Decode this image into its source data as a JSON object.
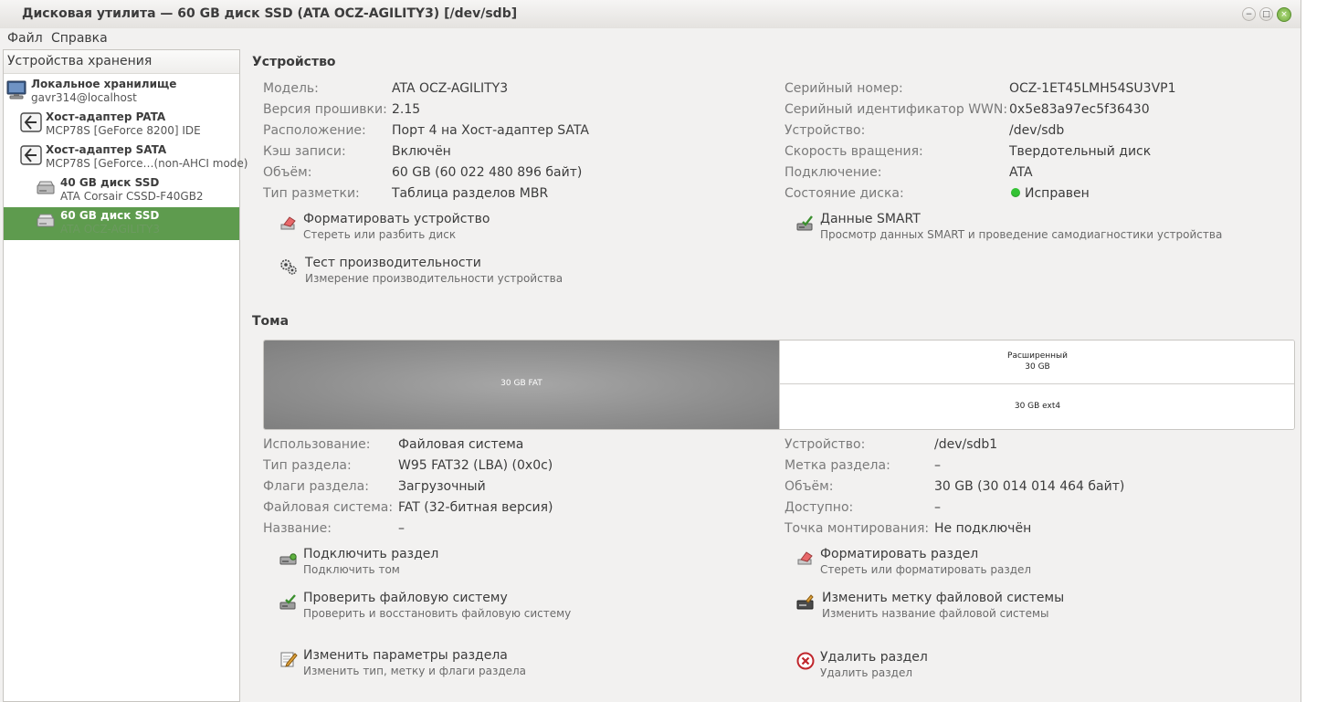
{
  "window": {
    "title": "Дисковая утилита — 60 GB диск SSD (ATA OCZ-AGILITY3) [/dev/sdb]",
    "min_glyph": "−",
    "max_glyph": "□",
    "close_glyph": "×"
  },
  "menu": {
    "file": "Файл",
    "help": "Справка"
  },
  "sidebar": {
    "header": "Устройства хранения",
    "items": [
      {
        "title": "Локальное хранилище",
        "subtitle": "gavr314@localhost",
        "icon": "computer-icon"
      },
      {
        "title": "Хост-адаптер PATA",
        "subtitle": "MCP78S [GeForce 8200] IDE",
        "icon": "adapter-icon"
      },
      {
        "title": "Хост-адаптер SATA",
        "subtitle": "MCP78S [GeForce…(non-AHCI mode)",
        "icon": "adapter-icon"
      },
      {
        "title": "40 GB диск SSD",
        "subtitle": "ATA Corsair CSSD-F40GB2",
        "icon": "drive-icon"
      },
      {
        "title": "60 GB диск SSD",
        "subtitle": "ATA OCZ-AGILITY3",
        "icon": "drive-icon"
      }
    ]
  },
  "device": {
    "section_title": "Устройство",
    "left": [
      {
        "label": "Модель:",
        "value": "ATA OCZ-AGILITY3"
      },
      {
        "label": "Версия прошивки:",
        "value": "2.15"
      },
      {
        "label": "Расположение:",
        "value": "Порт 4 на Хост-адаптер SATA"
      },
      {
        "label": "Кэш записи:",
        "value": "Включён"
      },
      {
        "label": "Объём:",
        "value": "60 GB (60 022 480 896 байт)"
      },
      {
        "label": "Тип разметки:",
        "value": "Таблица разделов MBR"
      }
    ],
    "right": [
      {
        "label": "Серийный номер:",
        "value": "OCZ-1ET45LMH54SU3VP1"
      },
      {
        "label": "Серийный идентификатор WWN:",
        "value": "0x5e83a97ec5f36430"
      },
      {
        "label": "Устройство:",
        "value": "/dev/sdb"
      },
      {
        "label": "Скорость вращения:",
        "value": "Твердотельный диск"
      },
      {
        "label": "Подключение:",
        "value": "ATA"
      },
      {
        "label": "Состояние диска:",
        "value": "Исправен"
      }
    ],
    "status_color": "#34c234",
    "actions": {
      "format": {
        "title": "Форматировать устройство",
        "desc": "Стереть или разбить диск"
      },
      "benchmark": {
        "title": "Тест производительности",
        "desc": "Измерение производительности устройства"
      },
      "smart": {
        "title": "Данные SMART",
        "desc": "Просмотр данных SMART и проведение самодиагностики устройства"
      }
    }
  },
  "volumes": {
    "section_title": "Тома",
    "fat_label": "30 GB FAT",
    "extended_label": "Расширенный",
    "extended_size": "30 GB",
    "ext4_label": "30 GB ext4"
  },
  "partition": {
    "left": [
      {
        "label": "Использование:",
        "value": "Файловая система"
      },
      {
        "label": "Тип раздела:",
        "value": "W95 FAT32 (LBA) (0x0c)"
      },
      {
        "label": "Флаги раздела:",
        "value": "Загрузочный"
      },
      {
        "label": "Файловая система:",
        "value": "FAT (32-битная версия)"
      },
      {
        "label": "Название:",
        "value": "–"
      }
    ],
    "right": [
      {
        "label": "Устройство:",
        "value": "/dev/sdb1"
      },
      {
        "label": "Метка раздела:",
        "value": "–"
      },
      {
        "label": "Объём:",
        "value": "30 GB (30 014 014 464 байт)"
      },
      {
        "label": "Доступно:",
        "value": "–"
      },
      {
        "label": "Точка монтирования:",
        "value": "Не подключён"
      }
    ],
    "actions": {
      "mount": {
        "title": "Подключить раздел",
        "desc": "Подключить том"
      },
      "check": {
        "title": "Проверить файловую систему",
        "desc": "Проверить и восстановить файловую систему"
      },
      "edit": {
        "title": "Изменить параметры раздела",
        "desc": "Изменить тип, метку и флаги раздела"
      },
      "format": {
        "title": "Форматировать раздел",
        "desc": "Стереть или форматировать раздел"
      },
      "label": {
        "title": "Изменить метку файловой системы",
        "desc": "Изменить название файловой системы"
      },
      "delete": {
        "title": "Удалить раздел",
        "desc": "Удалить раздел"
      }
    }
  }
}
